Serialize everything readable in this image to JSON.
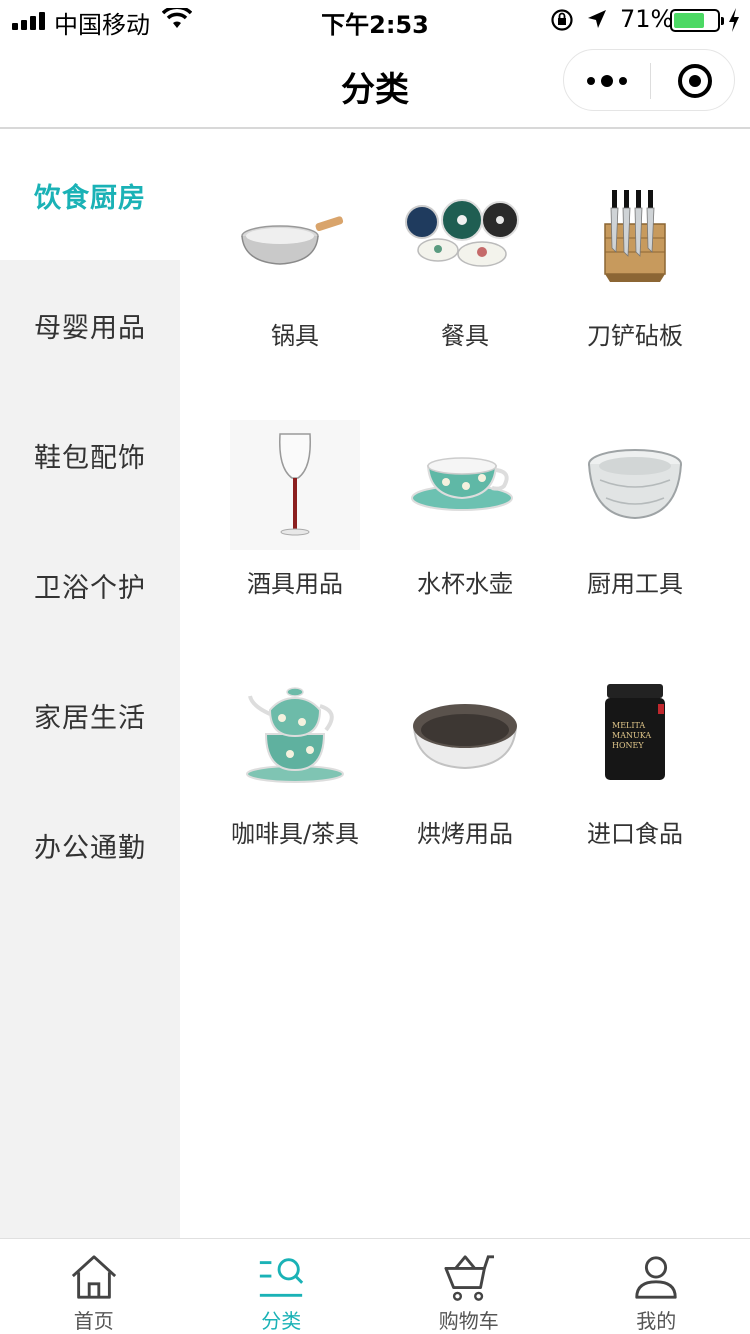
{
  "status_bar": {
    "carrier": "中国移动",
    "time": "下午2:53",
    "battery_percent": "71%",
    "battery_level": 0.71
  },
  "nav": {
    "title": "分类"
  },
  "sidebar": {
    "items": [
      {
        "label": "饮食厨房",
        "active": true
      },
      {
        "label": "母婴用品",
        "active": false
      },
      {
        "label": "鞋包配饰",
        "active": false
      },
      {
        "label": "卫浴个护",
        "active": false
      },
      {
        "label": "家居生活",
        "active": false
      },
      {
        "label": "办公通勤",
        "active": false
      }
    ]
  },
  "categories": [
    {
      "label": "锅具",
      "icon": "saucepan-image"
    },
    {
      "label": "餐具",
      "icon": "plates-image"
    },
    {
      "label": "刀铲砧板",
      "icon": "knife-block-image"
    },
    {
      "label": "酒具用品",
      "icon": "wine-glass-image"
    },
    {
      "label": "水杯水壶",
      "icon": "teacup-image"
    },
    {
      "label": "厨用工具",
      "icon": "glass-bowl-image"
    },
    {
      "label": "咖啡具/茶具",
      "icon": "teapot-image"
    },
    {
      "label": "烘烤用品",
      "icon": "baking-pan-image"
    },
    {
      "label": "进口食品",
      "icon": "honey-jar-image"
    }
  ],
  "honey_label": {
    "brand": "MELITA",
    "line1": "MANUKA",
    "line2": "HONEY"
  },
  "tab_bar": {
    "tabs": [
      {
        "label": "首页",
        "icon": "home-icon",
        "active": false
      },
      {
        "label": "分类",
        "icon": "category-search-icon",
        "active": true
      },
      {
        "label": "购物车",
        "icon": "cart-icon",
        "active": false
      },
      {
        "label": "我的",
        "icon": "user-icon",
        "active": false
      }
    ]
  },
  "colors": {
    "accent": "#1ab2b6",
    "sidebar_bg": "#f2f2f2",
    "battery": "#4cd964"
  }
}
